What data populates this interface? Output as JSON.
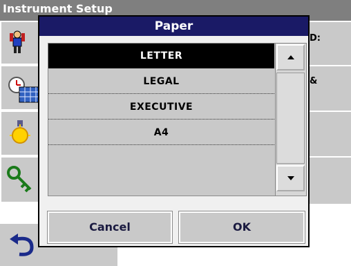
{
  "background": {
    "title": "Instrument Setup",
    "right_fragments": [
      "D:",
      "&"
    ]
  },
  "dialog": {
    "title": "Paper",
    "options": [
      {
        "label": "LETTER",
        "selected": true
      },
      {
        "label": "LEGAL",
        "selected": false
      },
      {
        "label": "EXECUTIVE",
        "selected": false
      },
      {
        "label": "A4",
        "selected": false
      }
    ],
    "cancel_label": "Cancel",
    "ok_label": "OK"
  },
  "icons": {
    "operator": "operator-icon",
    "clock": "clock-calendar-icon",
    "lamp": "lamp-icon",
    "key": "key-icon",
    "back": "back-arrow-icon"
  },
  "colors": {
    "header": "#1a1a66",
    "selected_bg": "#000000",
    "panel": "#c9c9c9"
  }
}
